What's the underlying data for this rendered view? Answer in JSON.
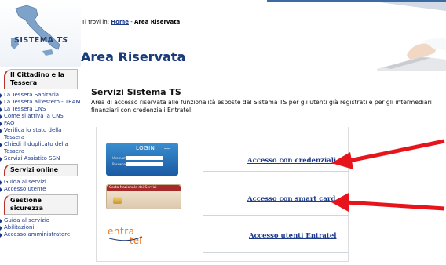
{
  "logo": {
    "text_main": "SISTEMA",
    "text_ts": "TS"
  },
  "breadcrumb": {
    "prefix": "Ti trovi in:",
    "home": "Home",
    "separator": " - ",
    "current": "Area Riservata"
  },
  "page_title": "Area Riservata",
  "sidebar": {
    "section1": {
      "title": "Il Cittadino e la Tessera",
      "items": [
        "La Tessera Sanitaria",
        "La Tessera all'estero - TEAM",
        "La Tessera CNS",
        "Come si attiva la CNS",
        "FAQ",
        "Verifica lo stato della Tessera",
        "Chiedi il duplicato della Tessera",
        "Servizi Assistito SSN"
      ]
    },
    "section2": {
      "title": "Servizi online",
      "items": [
        "Guida ai servizi",
        "Accesso utente"
      ]
    },
    "section3": {
      "title": "Gestione sicurezza",
      "items": [
        "Guida al servizio",
        "Abilitazioni",
        "Accesso amministratore"
      ]
    }
  },
  "main": {
    "section_title": "Servizi Sistema TS",
    "description": "Area di accesso riservata alle funzionalità esposte dal Sistema TS per gli utenti già registrati e per gli intermediari finanziari con credenziali Entratel.",
    "services": [
      {
        "link": "Accesso con credenziali",
        "image": "login-card-image"
      },
      {
        "link": "Accesso con smart card",
        "image": "smart-card-image"
      },
      {
        "link": "Accesso utenti Entratel",
        "image": "entratel-logo"
      }
    ],
    "login_card": {
      "title": "LOGIN",
      "field1_label": "Username",
      "field2_label": "Password"
    },
    "smart_card": {
      "band": "Carta Nazionale dei Servizi"
    },
    "entratel": {
      "part1": "entra",
      "part2": "tel"
    }
  },
  "annotations": {
    "arrow_color": "#e8141b"
  }
}
